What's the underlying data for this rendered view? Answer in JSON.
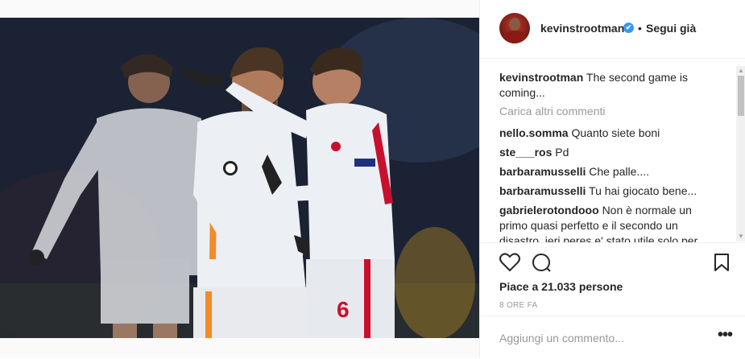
{
  "post": {
    "author": "kevinstrootman",
    "verified_mark": "✔",
    "separator": "•",
    "follow_status": "Segui già"
  },
  "comments": {
    "caption_user": "kevinstrootman",
    "caption_text": "The second game is coming...",
    "load_more": "Carica altri commenti",
    "items": [
      {
        "user": "nello.somma",
        "text": "Quanto siete boni"
      },
      {
        "user": "ste___ros",
        "text": "Pd"
      },
      {
        "user": "barbaramusselli",
        "text": "Che palle...."
      },
      {
        "user": "barbaramusselli",
        "text": "Tu hai giocato bene..."
      },
      {
        "user": "gabrielerotondooo",
        "text": "Non è normale un primo quasi perfetto e il secondo un disastro. ieri peres e' stato utile solo per"
      }
    ]
  },
  "actions": {
    "like_icon": "heart-outline-icon",
    "comment_icon": "comment-bubble-icon",
    "save_icon": "bookmark-icon",
    "likes_text": "Piace a 21.033 persone",
    "time_text": "8 ORE FA"
  },
  "composer": {
    "placeholder": "Aggiungi un commento...",
    "more_label": "•••"
  },
  "photo": {
    "jersey_number": "6",
    "colors": {
      "kit": "#eceff3",
      "accent": "#c8102e",
      "orange": "#f28c28"
    }
  }
}
